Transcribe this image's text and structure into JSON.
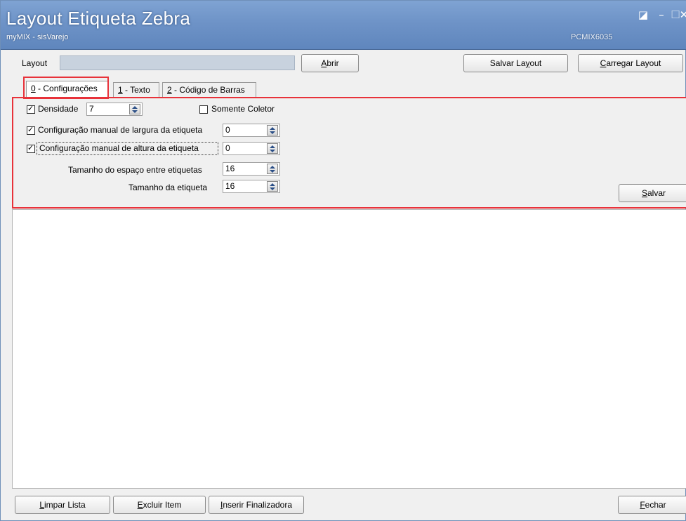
{
  "window": {
    "title": "Layout Etiqueta Zebra",
    "subtitle": "myMIX - sisVarejo",
    "code": "PCMIX6035",
    "controls": {
      "edit_icon": "edit-icon",
      "min_icon": "minimize-icon",
      "max_icon": "maximize-icon",
      "close_icon": "close-icon"
    },
    "edit_glyph": "◪",
    "min_glyph": "–",
    "max_glyph": "☐",
    "close_glyph": "✕"
  },
  "layout_row": {
    "label": "Layout",
    "value": "",
    "abrir_label_pre": "",
    "abrir_label_u": "A",
    "abrir_label_post": "brir",
    "salvar_layout_pre": "Salvar La",
    "salvar_layout_u": "y",
    "salvar_layout_post": "out",
    "carregar_layout_pre": "",
    "carregar_layout_u": "C",
    "carregar_layout_post": "arregar Layout"
  },
  "tabs": [
    {
      "u": "0",
      "label": " - Configurações",
      "active": true
    },
    {
      "u": "1",
      "label": " - Texto",
      "active": false
    },
    {
      "u": "2",
      "label": " - Código de Barras",
      "active": false
    }
  ],
  "config": {
    "densidade": {
      "label": "Densidade",
      "checked": true,
      "value": "7"
    },
    "somente_coletor": {
      "label": "Somente Coletor",
      "checked": false
    },
    "largura_manual": {
      "label": "Configuração manual de largura da etiqueta",
      "checked": true,
      "value": "0"
    },
    "altura_manual": {
      "label": "Configuração manual de altura da etiqueta",
      "checked": true,
      "value": "0"
    },
    "espaco": {
      "label": "Tamanho do espaço entre etiquetas",
      "value": "16"
    },
    "tamanho": {
      "label": "Tamanho da etiqueta",
      "value": "16"
    },
    "salvar_pre": "",
    "salvar_u": "S",
    "salvar_post": "alvar"
  },
  "bottom": {
    "limpar_u": "L",
    "limpar_post": "impar Lista",
    "excluir_u": "E",
    "excluir_post": "xcluir Item",
    "inserir_u": "I",
    "inserir_post": "nserir Finalizadora",
    "fechar_u": "F",
    "fechar_post": "echar"
  },
  "colors": {
    "titlebar": "#6e93c7",
    "highlight": "#e8323a",
    "layout_input": "#c8d2de"
  }
}
